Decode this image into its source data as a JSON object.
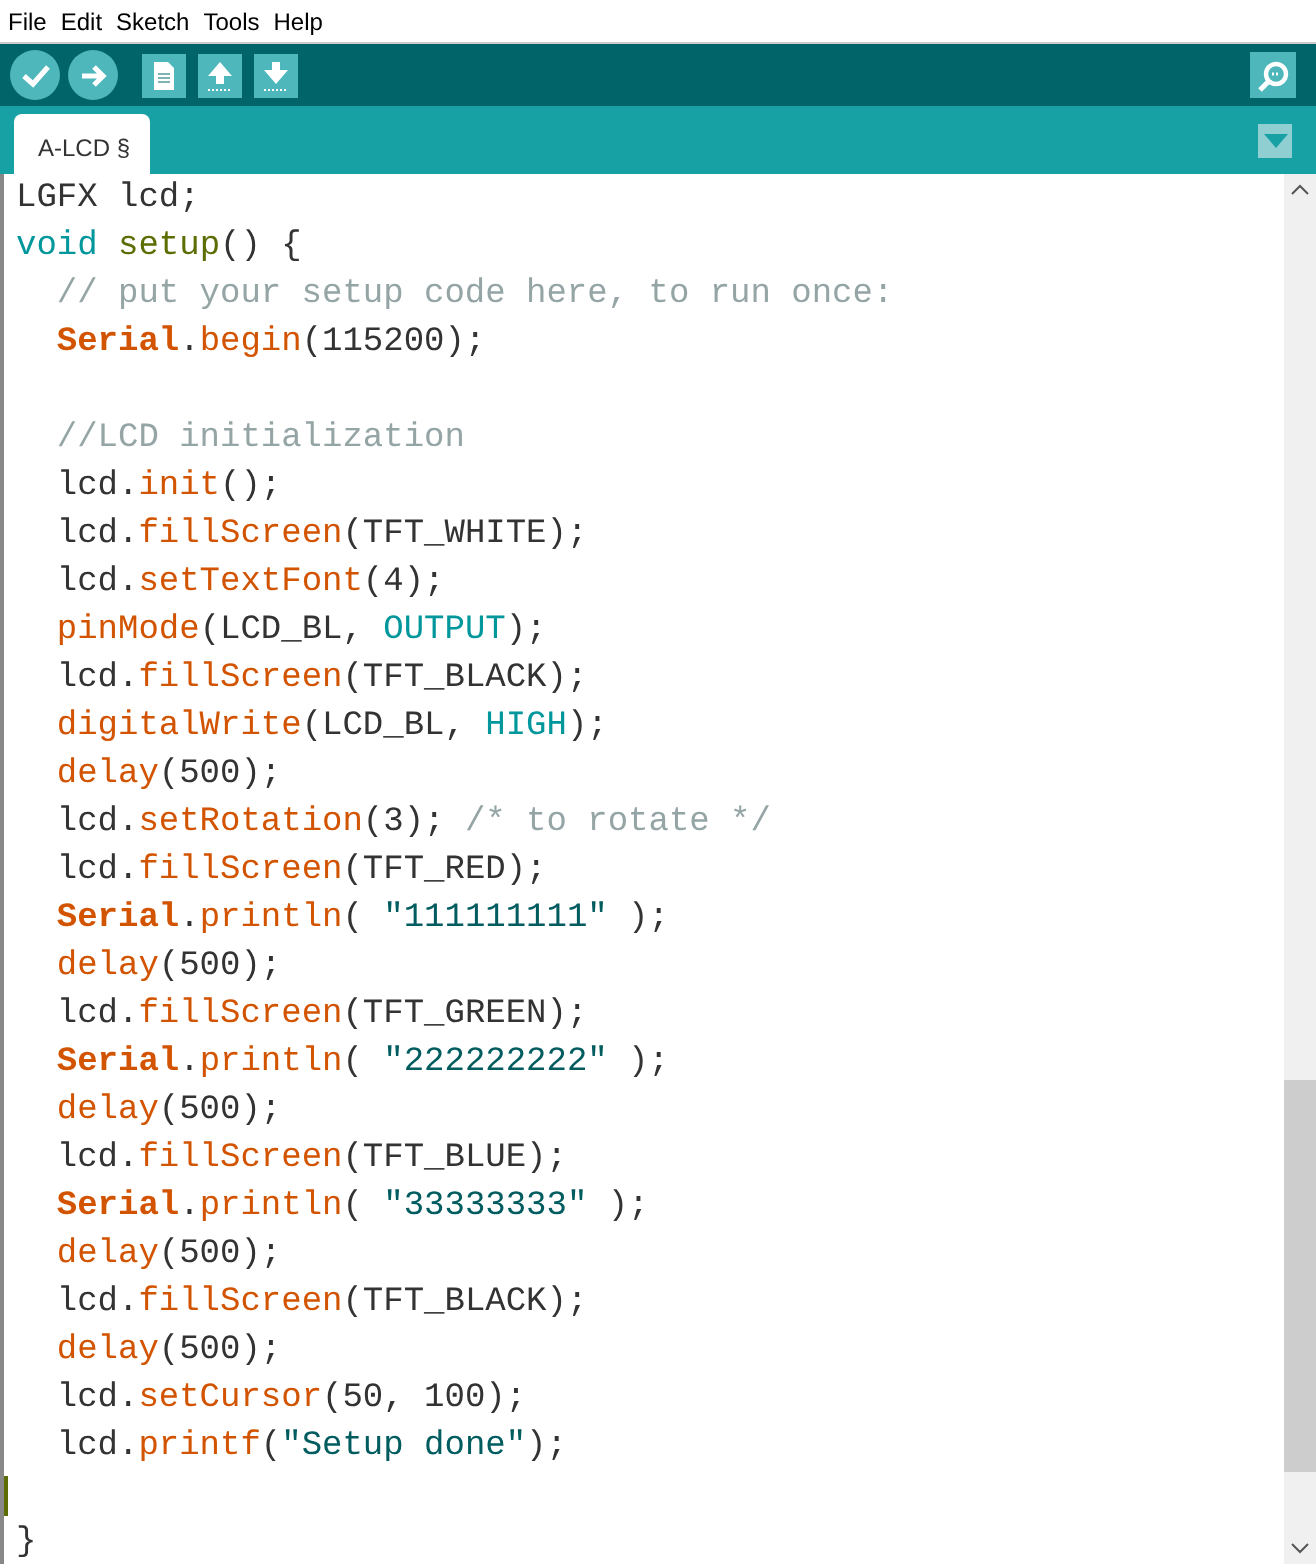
{
  "menu": [
    "File",
    "Edit",
    "Sketch",
    "Tools",
    "Help"
  ],
  "toolbar": {
    "buttons": [
      {
        "kind": "verify"
      },
      {
        "kind": "upload"
      },
      {
        "kind": "new"
      },
      {
        "kind": "open"
      },
      {
        "kind": "save"
      }
    ],
    "right": {
      "kind": "monitor"
    }
  },
  "tabs": [
    {
      "label": "A-LCD §",
      "selected": true
    }
  ],
  "editor": {
    "lines": [
      {
        "indented": false,
        "tokens": [
          {
            "kind": "plain",
            "text": "LGFX lcd;"
          }
        ]
      },
      {
        "indented": false,
        "tokens": [
          {
            "kind": "type",
            "text": "void"
          },
          {
            "kind": "name",
            "text": " setup"
          },
          {
            "kind": "plain",
            "text": "() {"
          }
        ]
      },
      {
        "indented": true,
        "tokens": [
          {
            "kind": "comment",
            "text": "// put your setup code here, to run once:"
          }
        ]
      },
      {
        "indented": true,
        "tokens": [
          {
            "kind": "bold",
            "text": "Serial"
          },
          {
            "kind": "plain",
            "text": "."
          },
          {
            "kind": "function",
            "text": "begin"
          },
          {
            "kind": "plain",
            "text": "(115200);"
          }
        ]
      },
      {
        "indented": true,
        "gap_before": true,
        "tokens": [
          {
            "kind": "comment",
            "text": "//LCD initialization"
          }
        ]
      },
      {
        "indented": true,
        "tokens": [
          {
            "kind": "plain",
            "text": "lcd."
          },
          {
            "kind": "function",
            "text": "init"
          },
          {
            "kind": "plain",
            "text": "();"
          }
        ]
      },
      {
        "indented": true,
        "tokens": [
          {
            "kind": "plain",
            "text": "lcd."
          },
          {
            "kind": "function",
            "text": "fillScreen"
          },
          {
            "kind": "plain",
            "text": "(TFT_WHITE);"
          }
        ]
      },
      {
        "indented": true,
        "tokens": [
          {
            "kind": "plain",
            "text": "lcd."
          },
          {
            "kind": "function",
            "text": "setTextFont"
          },
          {
            "kind": "plain",
            "text": "(4);"
          }
        ]
      },
      {
        "indented": true,
        "tokens": [
          {
            "kind": "function",
            "text": "pinMode"
          },
          {
            "kind": "plain",
            "text": "(LCD_BL, "
          },
          {
            "kind": "constant",
            "text": "OUTPUT"
          },
          {
            "kind": "plain",
            "text": ");"
          }
        ]
      },
      {
        "indented": true,
        "tokens": [
          {
            "kind": "plain",
            "text": "lcd."
          },
          {
            "kind": "function",
            "text": "fillScreen"
          },
          {
            "kind": "plain",
            "text": "(TFT_BLACK);"
          }
        ]
      },
      {
        "indented": true,
        "tokens": [
          {
            "kind": "function",
            "text": "digitalWrite"
          },
          {
            "kind": "plain",
            "text": "(LCD_BL, "
          },
          {
            "kind": "constant",
            "text": "HIGH"
          },
          {
            "kind": "plain",
            "text": ");"
          }
        ]
      },
      {
        "indented": true,
        "tokens": [
          {
            "kind": "function",
            "text": "delay"
          },
          {
            "kind": "plain",
            "text": "(500);"
          }
        ]
      },
      {
        "indented": true,
        "tokens": [
          {
            "kind": "plain",
            "text": "lcd."
          },
          {
            "kind": "function",
            "text": "setRotation"
          },
          {
            "kind": "plain",
            "text": "(3); "
          },
          {
            "kind": "comment",
            "text": "/* to rotate */"
          }
        ]
      },
      {
        "indented": true,
        "tokens": [
          {
            "kind": "plain",
            "text": "lcd."
          },
          {
            "kind": "function",
            "text": "fillScreen"
          },
          {
            "kind": "plain",
            "text": "(TFT_RED);"
          }
        ]
      },
      {
        "indented": true,
        "tokens": [
          {
            "kind": "bold",
            "text": "Serial"
          },
          {
            "kind": "plain",
            "text": "."
          },
          {
            "kind": "function",
            "text": "println"
          },
          {
            "kind": "plain",
            "text": "( "
          },
          {
            "kind": "string",
            "text": "\"111111111\""
          },
          {
            "kind": "plain",
            "text": " );"
          }
        ]
      },
      {
        "indented": true,
        "tokens": [
          {
            "kind": "function",
            "text": "delay"
          },
          {
            "kind": "plain",
            "text": "(500);"
          }
        ]
      },
      {
        "indented": true,
        "tokens": [
          {
            "kind": "plain",
            "text": "lcd."
          },
          {
            "kind": "function",
            "text": "fillScreen"
          },
          {
            "kind": "plain",
            "text": "(TFT_GREEN);"
          }
        ]
      },
      {
        "indented": true,
        "tokens": [
          {
            "kind": "bold",
            "text": "Serial"
          },
          {
            "kind": "plain",
            "text": "."
          },
          {
            "kind": "function",
            "text": "println"
          },
          {
            "kind": "plain",
            "text": "( "
          },
          {
            "kind": "string",
            "text": "\"222222222\""
          },
          {
            "kind": "plain",
            "text": " );"
          }
        ]
      },
      {
        "indented": true,
        "tokens": [
          {
            "kind": "function",
            "text": "delay"
          },
          {
            "kind": "plain",
            "text": "(500);"
          }
        ]
      },
      {
        "indented": true,
        "tokens": [
          {
            "kind": "plain",
            "text": "lcd."
          },
          {
            "kind": "function",
            "text": "fillScreen"
          },
          {
            "kind": "plain",
            "text": "(TFT_BLUE);"
          }
        ]
      },
      {
        "indented": true,
        "tokens": [
          {
            "kind": "bold",
            "text": "Serial"
          },
          {
            "kind": "plain",
            "text": "."
          },
          {
            "kind": "function",
            "text": "println"
          },
          {
            "kind": "plain",
            "text": "( "
          },
          {
            "kind": "string",
            "text": "\"33333333\""
          },
          {
            "kind": "plain",
            "text": " );"
          }
        ]
      },
      {
        "indented": true,
        "tokens": [
          {
            "kind": "function",
            "text": "delay"
          },
          {
            "kind": "plain",
            "text": "(500);"
          }
        ]
      },
      {
        "indented": true,
        "tokens": [
          {
            "kind": "plain",
            "text": "lcd."
          },
          {
            "kind": "function",
            "text": "fillScreen"
          },
          {
            "kind": "plain",
            "text": "(TFT_BLACK);"
          }
        ]
      },
      {
        "indented": true,
        "tokens": [
          {
            "kind": "function",
            "text": "delay"
          },
          {
            "kind": "plain",
            "text": "(500);"
          }
        ]
      },
      {
        "indented": true,
        "tokens": [
          {
            "kind": "plain",
            "text": "lcd."
          },
          {
            "kind": "function",
            "text": "setCursor"
          },
          {
            "kind": "plain",
            "text": "(50, 100);"
          }
        ]
      },
      {
        "indented": true,
        "tokens": [
          {
            "kind": "plain",
            "text": "lcd."
          },
          {
            "kind": "function",
            "text": "printf"
          },
          {
            "kind": "plain",
            "text": "("
          },
          {
            "kind": "string",
            "text": "\"Setup done\""
          },
          {
            "kind": "plain",
            "text": ");"
          }
        ]
      },
      {
        "caret": true
      },
      {
        "indented": false,
        "tokens": [
          {
            "kind": "plain",
            "text": "}"
          }
        ]
      }
    ]
  }
}
